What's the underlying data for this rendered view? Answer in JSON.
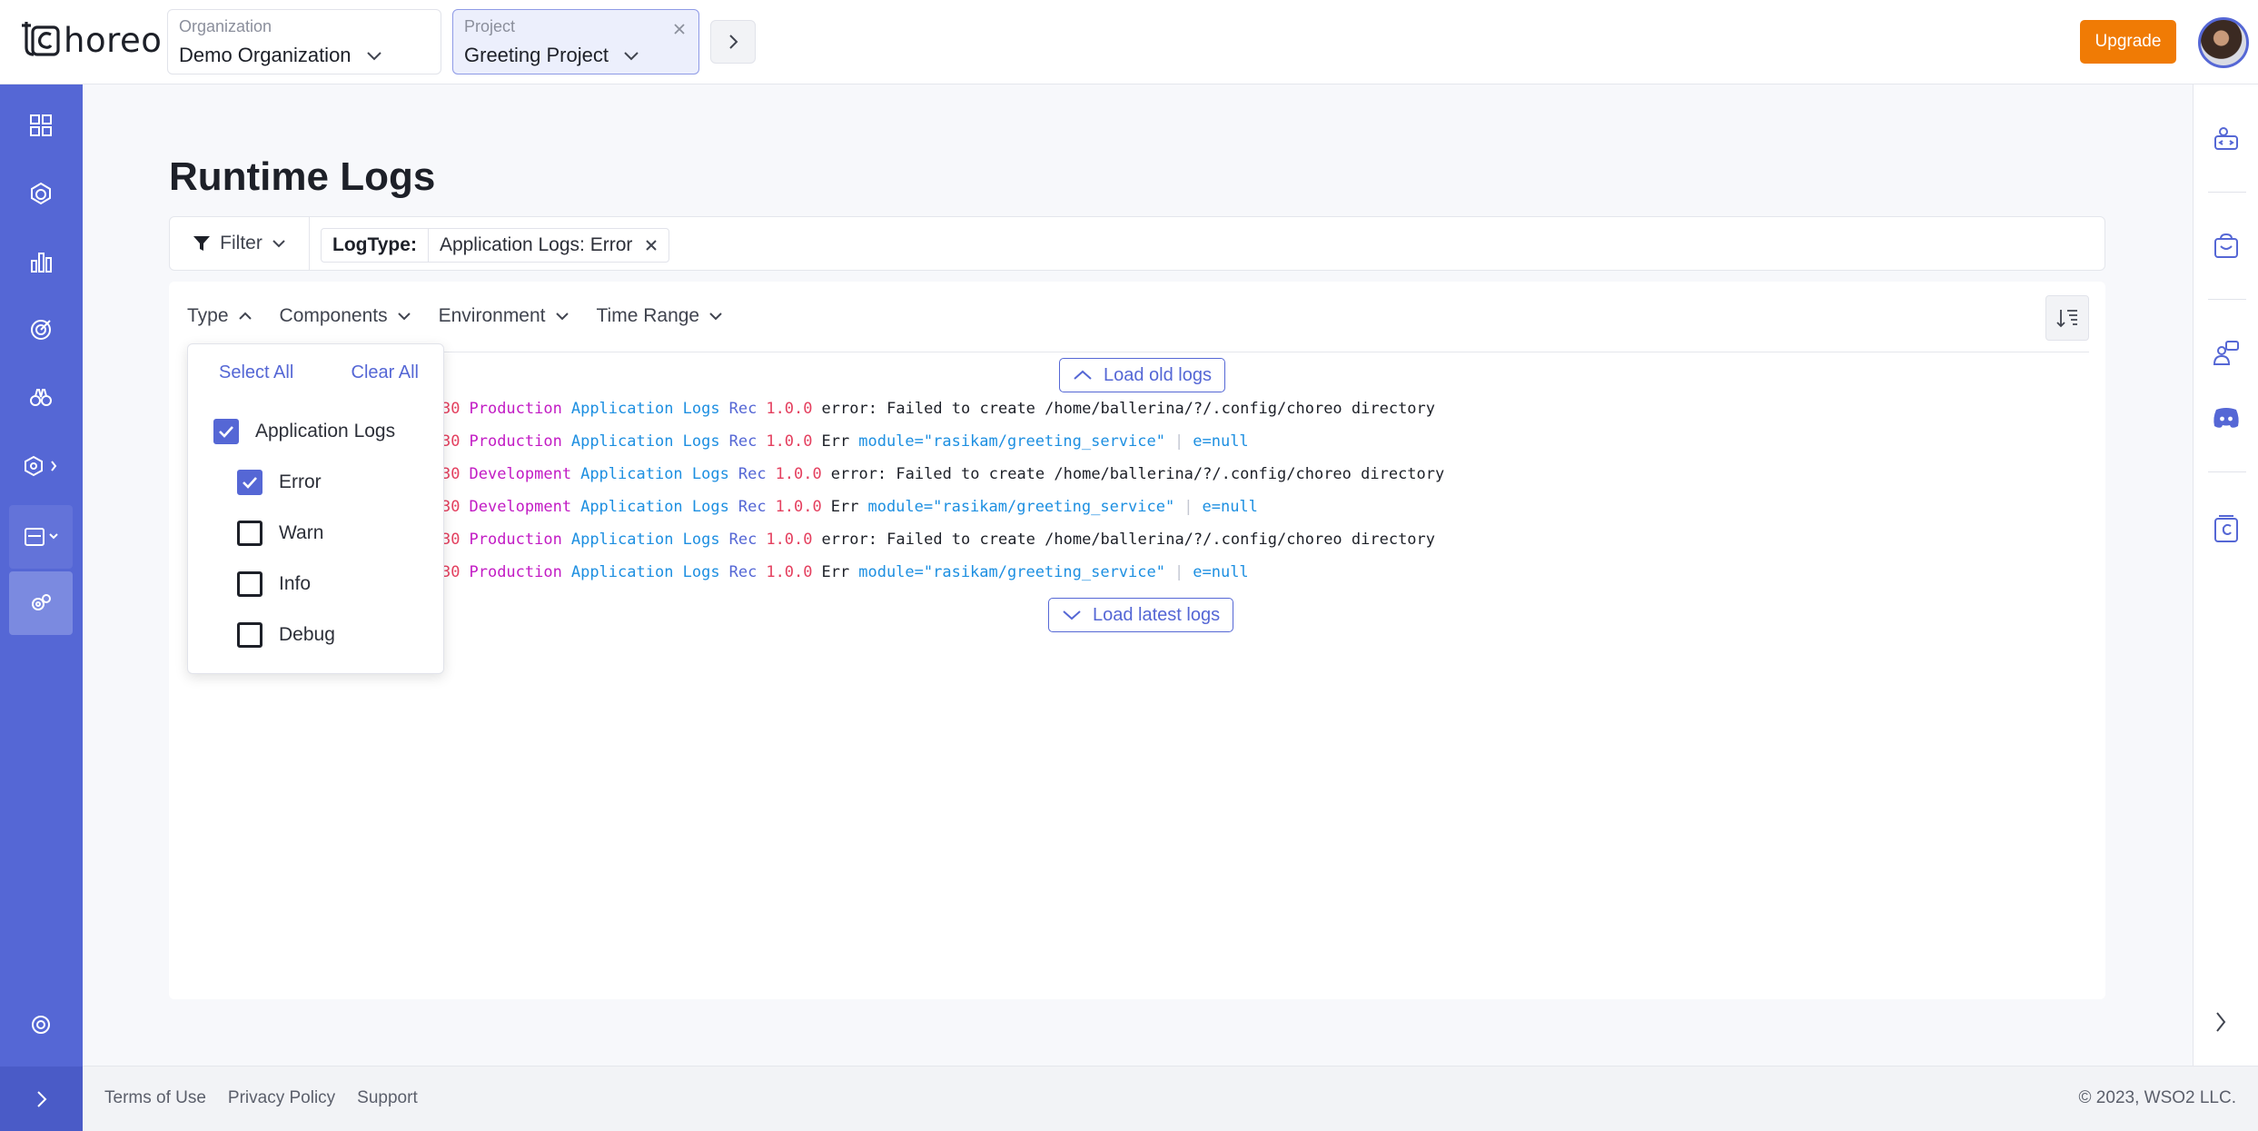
{
  "app": {
    "logo_text": "horeo",
    "upgrade_label": "Upgrade"
  },
  "org_selector": {
    "label": "Organization",
    "value": "Demo Organization"
  },
  "project_selector": {
    "label": "Project",
    "value": "Greeting Project"
  },
  "page": {
    "title": "Runtime Logs"
  },
  "filter_bar": {
    "filter_label": "Filter",
    "chip_key": "LogType:",
    "chip_value": "Application Logs: Error"
  },
  "tabs": [
    "Type",
    "Components",
    "Environment",
    "Time Range"
  ],
  "load_old_label": "Load old logs",
  "load_latest_label": "Load latest logs",
  "logs": [
    {
      "ts": "30",
      "env": "Production",
      "type": "Application Logs",
      "comp": "Rec",
      "ver": "1.0.0",
      "msg": "error: Failed to create /home/ballerina/?/.config/choreo directory",
      "kv": []
    },
    {
      "ts": "30",
      "env": "Production",
      "type": "Application Logs",
      "comp": "Rec",
      "ver": "1.0.0",
      "msg": "Err",
      "kv": [
        "module=\"rasikam/greeting_service\"",
        "e=null"
      ]
    },
    {
      "ts": "30",
      "env": "Development",
      "type": "Application Logs",
      "comp": "Rec",
      "ver": "1.0.0",
      "msg": "error: Failed to create /home/ballerina/?/.config/choreo directory",
      "kv": []
    },
    {
      "ts": "30",
      "env": "Development",
      "type": "Application Logs",
      "comp": "Rec",
      "ver": "1.0.0",
      "msg": "Err",
      "kv": [
        "module=\"rasikam/greeting_service\"",
        "e=null"
      ]
    },
    {
      "ts": "30",
      "env": "Production",
      "type": "Application Logs",
      "comp": "Rec",
      "ver": "1.0.0",
      "msg": "error: Failed to create /home/ballerina/?/.config/choreo directory",
      "kv": []
    },
    {
      "ts": "30",
      "env": "Production",
      "type": "Application Logs",
      "comp": "Rec",
      "ver": "1.0.0",
      "msg": "Err",
      "kv": [
        "module=\"rasikam/greeting_service\"",
        "e=null"
      ]
    }
  ],
  "type_dropdown": {
    "select_all": "Select All",
    "clear_all": "Clear All",
    "options": [
      {
        "label": "Application Logs",
        "checked": true
      },
      {
        "label": "Error",
        "checked": true
      },
      {
        "label": "Warn",
        "checked": false
      },
      {
        "label": "Info",
        "checked": false
      },
      {
        "label": "Debug",
        "checked": false
      }
    ]
  },
  "footer": {
    "links": [
      "Terms of Use",
      "Privacy Policy",
      "Support"
    ],
    "copyright": "© 2023, WSO2 LLC."
  },
  "colors": {
    "brand": "#5567d5",
    "upgrade": "#f07b05"
  }
}
